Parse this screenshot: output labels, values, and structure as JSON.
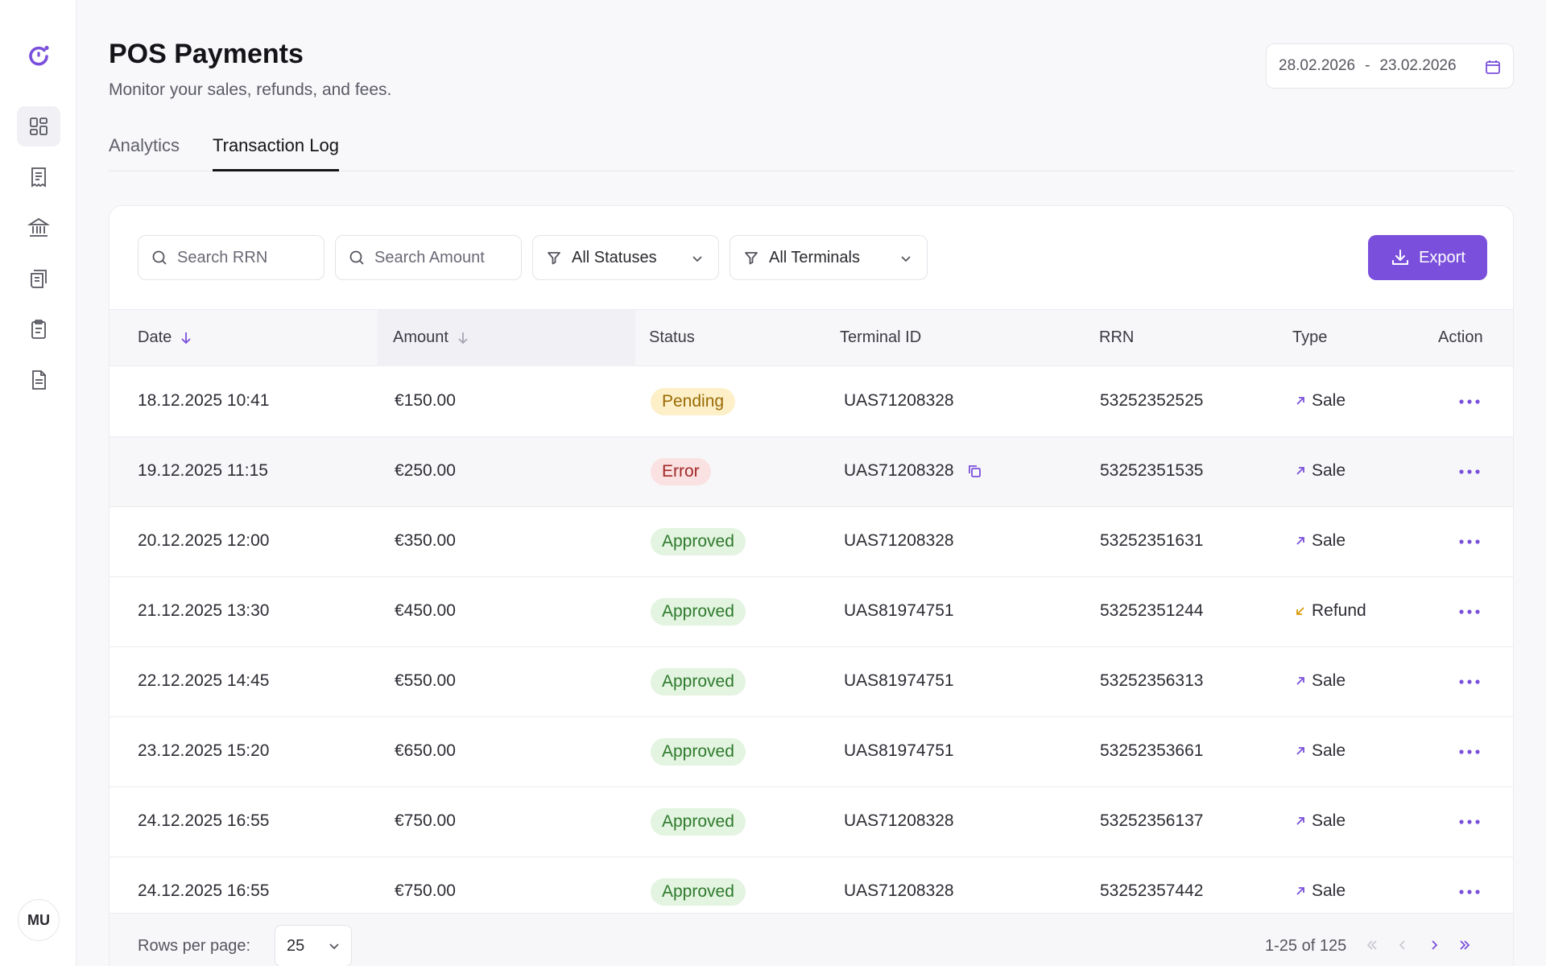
{
  "page": {
    "title": "POS Payments",
    "subtitle": "Monitor your sales, refunds, and fees."
  },
  "date_range": {
    "start": "28.02.2026",
    "separator": "-",
    "end": "23.02.2026"
  },
  "tabs": [
    {
      "label": "Analytics",
      "active": false
    },
    {
      "label": "Transaction Log",
      "active": true
    }
  ],
  "sidebar": {
    "logo_icon": "logo-icon",
    "items": [
      {
        "icon": "dashboard-icon",
        "active": true
      },
      {
        "icon": "receipt-icon",
        "active": false
      },
      {
        "icon": "bank-icon",
        "active": false
      },
      {
        "icon": "invoice-icon",
        "active": false
      },
      {
        "icon": "clipboard-icon",
        "active": false
      },
      {
        "icon": "document-icon",
        "active": false
      }
    ],
    "avatar_initials": "MU"
  },
  "filters": {
    "search_rrn_placeholder": "Search RRN",
    "search_amount_placeholder": "Search Amount",
    "status_label": "All Statuses",
    "terminal_label": "All Terminals",
    "export_label": "Export"
  },
  "table": {
    "columns": [
      "Date",
      "Amount",
      "Status",
      "Terminal ID",
      "RRN",
      "Type",
      "Action"
    ],
    "rows": [
      {
        "date": "18.12.2025 10:41",
        "amount": "€150.00",
        "status": "Pending",
        "terminal": "UAS71208328",
        "rrn": "53252352525",
        "type": "Sale"
      },
      {
        "date": "19.12.2025 11:15",
        "amount": "€250.00",
        "status": "Error",
        "terminal": "UAS71208328",
        "rrn": "53252351535",
        "type": "Sale"
      },
      {
        "date": "20.12.2025 12:00",
        "amount": "€350.00",
        "status": "Approved",
        "terminal": "UAS71208328",
        "rrn": "53252351631",
        "type": "Sale"
      },
      {
        "date": "21.12.2025 13:30",
        "amount": "€450.00",
        "status": "Approved",
        "terminal": "UAS81974751",
        "rrn": "53252351244",
        "type": "Refund"
      },
      {
        "date": "22.12.2025 14:45",
        "amount": "€550.00",
        "status": "Approved",
        "terminal": "UAS81974751",
        "rrn": "53252356313",
        "type": "Sale"
      },
      {
        "date": "23.12.2025 15:20",
        "amount": "€650.00",
        "status": "Approved",
        "terminal": "UAS81974751",
        "rrn": "53252353661",
        "type": "Sale"
      },
      {
        "date": "24.12.2025 16:55",
        "amount": "€750.00",
        "status": "Approved",
        "terminal": "UAS71208328",
        "rrn": "53252356137",
        "type": "Sale"
      },
      {
        "date": "24.12.2025 16:55",
        "amount": "€750.00",
        "status": "Approved",
        "terminal": "UAS71208328",
        "rrn": "53252357442",
        "type": "Sale"
      }
    ]
  },
  "pagination": {
    "rows_per_page_label": "Rows per page:",
    "rows_per_page_value": "25",
    "range_text": "1-25 of 125"
  },
  "colors": {
    "accent": "#7a4fdb",
    "pending_bg": "#fdf0c9",
    "error_bg": "#fbe2e2",
    "approved_bg": "#e3f4e1",
    "refund_arrow": "#d99a0a"
  }
}
